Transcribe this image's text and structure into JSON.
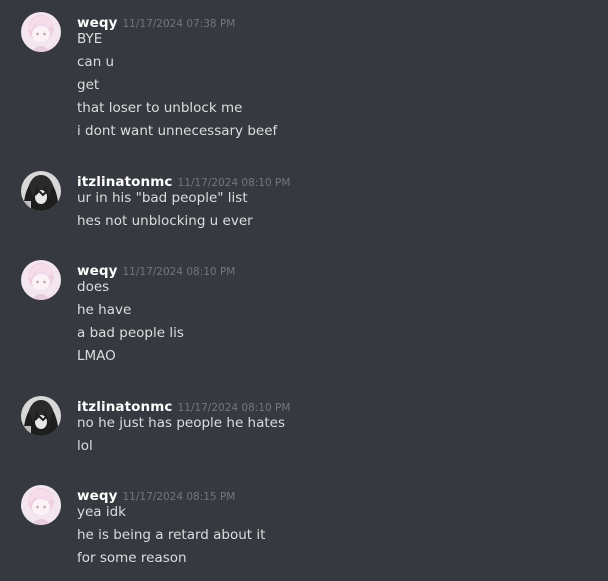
{
  "colors": {
    "background": "#36393f",
    "username": "#ffffff",
    "timestamp": "#72767d",
    "message_text": "#dcddde"
  },
  "messages": [
    {
      "username": "weqy",
      "timestamp": "11/17/2024 07:38 PM",
      "avatar_icon": "pink-anime-avatar-icon",
      "lines": [
        "BYE",
        "can u",
        "get",
        "that loser to unblock me",
        "i dont want unnecessary beef"
      ]
    },
    {
      "username": "itzlinatonmc",
      "timestamp": "11/17/2024 08:10 PM",
      "avatar_icon": "dark-anime-avatar-icon",
      "lines": [
        "ur in his \"bad people\" list",
        "hes not unblocking u ever"
      ]
    },
    {
      "username": "weqy",
      "timestamp": "11/17/2024 08:10 PM",
      "avatar_icon": "pink-anime-avatar-icon",
      "lines": [
        "does",
        "he have",
        "a bad people lis",
        "LMAO"
      ]
    },
    {
      "username": "itzlinatonmc",
      "timestamp": "11/17/2024 08:10 PM",
      "avatar_icon": "dark-anime-avatar-icon",
      "lines": [
        "no he just has people he hates",
        "lol"
      ]
    },
    {
      "username": "weqy",
      "timestamp": "11/17/2024 08:15 PM",
      "avatar_icon": "pink-anime-avatar-icon",
      "lines": [
        "yea idk",
        "he is being a retard about it",
        "for some reason"
      ]
    }
  ]
}
